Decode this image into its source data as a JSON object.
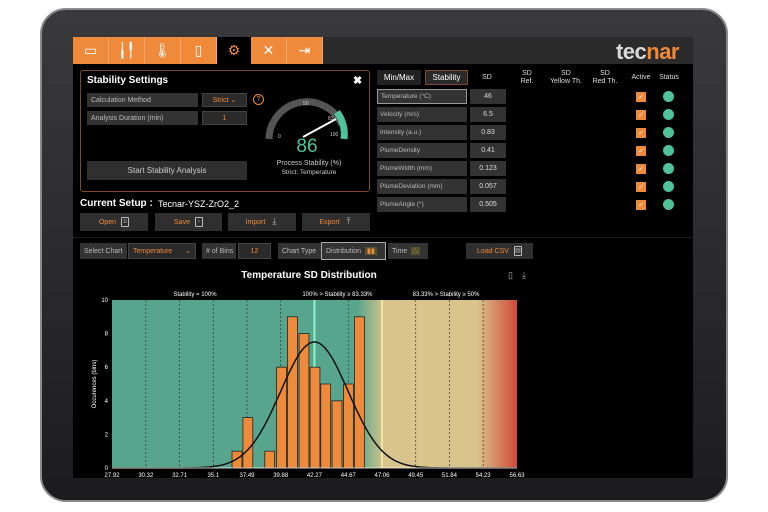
{
  "nav": {
    "tabs": [
      {
        "icon": "video-camera-icon"
      },
      {
        "icon": "chart-icon"
      },
      {
        "icon": "thermometer-icon"
      },
      {
        "icon": "report-icon"
      },
      {
        "icon": "gear-icon",
        "active": true
      },
      {
        "icon": "tools-icon"
      },
      {
        "icon": "logout-icon"
      }
    ],
    "logo_a": "tec",
    "logo_b": "nar"
  },
  "settings": {
    "title": "Stability Settings",
    "calc_label": "Calculation Method",
    "calc_value": "Strict",
    "duration_label": "Analysis Duration (min)",
    "duration_value": "1",
    "start_button": "Start Stability Analysis",
    "gauge": {
      "value": 86,
      "value_text": "86",
      "ticks": [
        "0",
        "50",
        "83",
        "100"
      ],
      "caption": "Process Stability (%)",
      "subcaption": "Strict: Temperature"
    }
  },
  "setup": {
    "label": "Current Setup :",
    "name": "Tecnar-YSZ-ZrO2_2",
    "buttons": [
      "Open",
      "Save",
      "Import",
      "Export"
    ]
  },
  "table": {
    "tabs": [
      "Min/Max",
      "Stability"
    ],
    "headers": [
      "SD",
      "SD\nRef.",
      "SD\nYellow Th.",
      "SD\nRed Th.",
      "Active",
      "Status"
    ],
    "rows": [
      {
        "name": "Temperature (°C)",
        "sd": "46"
      },
      {
        "name": "Velocity (m/s)",
        "sd": "6.5"
      },
      {
        "name": "Intensity (a.u.)",
        "sd": "0.83"
      },
      {
        "name": "PlumeDensity",
        "sd": "0.41"
      },
      {
        "name": "PlumeWidth (mm)",
        "sd": "0.123"
      },
      {
        "name": "PlumeDeviation (mm)",
        "sd": "0.057"
      },
      {
        "name": "PlumeAngle (°)",
        "sd": "0.505"
      }
    ]
  },
  "controls": {
    "select_chart_label": "Select Chart",
    "select_chart_value": "Temperature",
    "bins_label": "# of Bins",
    "bins_value": "12",
    "chart_type_label": "Chart Type",
    "distribution": "Distribution",
    "time": "Time",
    "load_csv": "Load CSV"
  },
  "colors": {
    "accent": "#ef8a3a",
    "green": "#57a58c",
    "yellow": "#d9c48c",
    "red": "#d24a3a",
    "status": "#4fc29a"
  },
  "chart_data": {
    "type": "bar",
    "title": "Temperature SD Distribution",
    "ylabel": "Occurences (bins)",
    "xlabel": "",
    "xticks": [
      "27.92",
      "30.32",
      "32.71",
      "35.1",
      "37.49",
      "39.88",
      "42.27",
      "44.67",
      "47.06",
      "49.45",
      "51.84",
      "54.23",
      "56.63"
    ],
    "xlim": [
      27.92,
      56.63
    ],
    "ylim": [
      0,
      10
    ],
    "yticks": [
      0,
      2,
      4,
      6,
      8,
      10
    ],
    "zones": [
      "Stability = 100%",
      "100% > Stability ≥ 83.33%",
      "83.33% > Stability ≥ 50%"
    ],
    "bins": [
      {
        "x": 36.78,
        "count": 1
      },
      {
        "x": 37.55,
        "count": 3
      },
      {
        "x": 39.1,
        "count": 1
      },
      {
        "x": 39.94,
        "count": 6
      },
      {
        "x": 40.72,
        "count": 9
      },
      {
        "x": 41.53,
        "count": 8
      },
      {
        "x": 42.31,
        "count": 6
      },
      {
        "x": 43.07,
        "count": 5
      },
      {
        "x": 43.87,
        "count": 4
      },
      {
        "x": 44.68,
        "count": 5
      },
      {
        "x": 45.46,
        "count": 9
      }
    ],
    "bin_width": 0.7,
    "fit": {
      "type": "normal",
      "mean": 42.27,
      "sigma": 2.4,
      "peak": 7.5
    },
    "mean_line": 42.27,
    "threshold_line": 47.06
  }
}
